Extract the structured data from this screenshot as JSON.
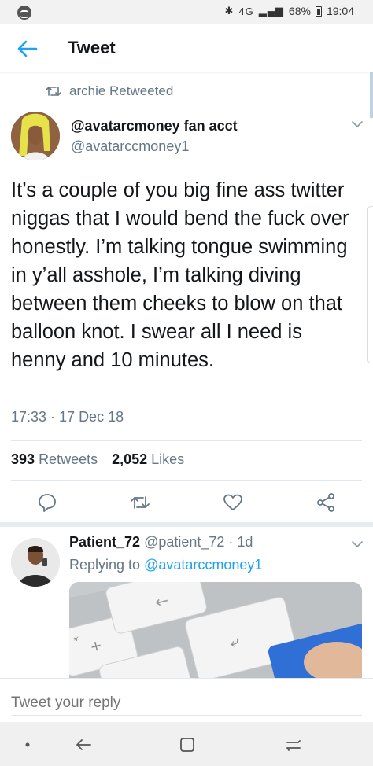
{
  "status_bar": {
    "network": "4G",
    "battery_percent": "68%",
    "time": "19:04",
    "icons": [
      "bluetooth-icon",
      "signal-icon",
      "battery-icon"
    ]
  },
  "app_bar": {
    "title": "Tweet",
    "back_icon": "back-arrow-icon"
  },
  "retweet": {
    "label": "archie Retweeted"
  },
  "tweet": {
    "author_name": "@avatarcmoney fan acct",
    "author_handle": "@avatarccmoney1",
    "text": "It’s a couple of you big fine ass twitter niggas that I would bend the fuck over honestly. I’m talking tongue swimming in y’all asshole, I’m talking diving between them cheeks to blow on that balloon knot. I swear all I need is henny and 10 minutes.",
    "timestamp": "17:33 · 17 Dec 18",
    "retweets_count": "393",
    "retweets_label": "Retweets",
    "likes_count": "2,052",
    "likes_label": "Likes"
  },
  "actions": [
    "reply-icon",
    "retweet-icon",
    "like-icon",
    "share-icon"
  ],
  "reply": {
    "name": "Patient_72",
    "handle": "@patient_72 · 1d",
    "replying_prefix": "Replying to",
    "replying_to": "@avatarccmoney1"
  },
  "reply_bar": {
    "placeholder": "Tweet your reply"
  },
  "nav": [
    "dot-icon",
    "back-icon",
    "home-square-icon",
    "recents-icon"
  ],
  "colors": {
    "accent": "#1da1f2",
    "secondary_text": "#657786",
    "primary_text": "#14171a",
    "divider": "#e1e8ed"
  }
}
